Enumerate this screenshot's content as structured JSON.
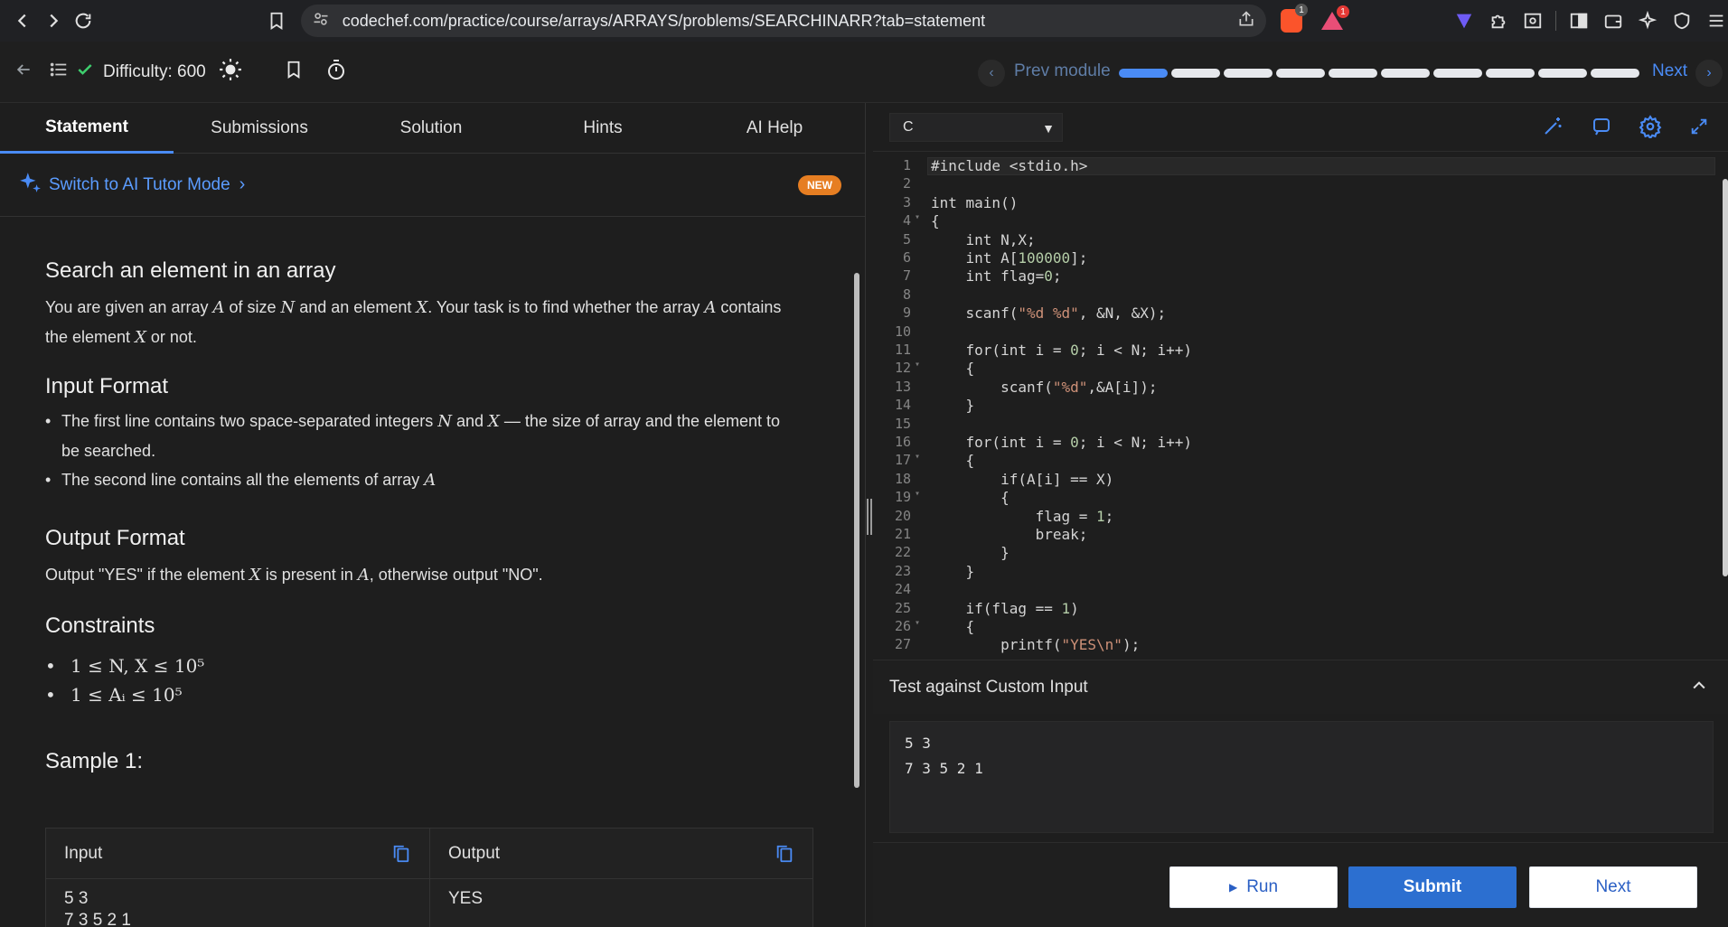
{
  "browser": {
    "url": "codechef.com/practice/course/arrays/ARRAYS/problems/SEARCHINARR?tab=statement",
    "shield_badge": "1",
    "alert_badge": "1"
  },
  "appbar": {
    "difficulty": "Difficulty:  600",
    "prev_label": "Prev module",
    "next_label": "Next",
    "progress_total": 10,
    "progress_done": 1
  },
  "tabs": [
    "Statement",
    "Submissions",
    "Solution",
    "Hints",
    "AI Help"
  ],
  "ai_tutor": {
    "link": "Switch to AI Tutor Mode",
    "badge": "NEW"
  },
  "problem": {
    "title": "Search an element in an array",
    "description": {
      "p1": "You are given an array ",
      "A": "A",
      "p2": " of size ",
      "N": "N",
      "p3": " and an element ",
      "X": "X",
      "p4": ". Your task is to find whether the array ",
      "p5": " contains",
      "p6": "the element ",
      "p7": " or not."
    },
    "input_format_title": "Input Format",
    "input_bullets": {
      "b1_a": "The first line contains two space-separated integers ",
      "b1_and": " and ",
      "b1_b": " — the size of array and the element to",
      "b1_c": "be searched.",
      "b2": "The second line contains all the elements of array "
    },
    "output_format_title": "Output Format",
    "output": {
      "o1": "Output \"YES\" if the element ",
      "o2": " is present in ",
      "o3": ", otherwise output \"NO\"."
    },
    "constraints_title": "Constraints",
    "constraints": [
      "1 ≤ N, X ≤ 10⁵",
      "1 ≤ Aᵢ ≤ 10⁵"
    ],
    "sample_title": "Sample 1:",
    "sample": {
      "input_label": "Input",
      "output_label": "Output",
      "input_line1": "5 3",
      "input_line2": "7 3 5 2 1",
      "output_value": "YES"
    }
  },
  "editor": {
    "language": "C",
    "lines": [
      "#include <stdio.h>",
      "",
      "int main()",
      "{",
      "    int N,X;",
      "    int A[100000];",
      "    int flag=0;",
      "",
      "    scanf(\"%d %d\", &N, &X);",
      "",
      "    for(int i = 0; i < N; i++)",
      "    {",
      "        scanf(\"%d\",&A[i]);",
      "    }",
      "",
      "    for(int i = 0; i < N; i++)",
      "    {",
      "        if(A[i] == X)",
      "        {",
      "            flag = 1;",
      "            break;",
      "        }",
      "    }",
      "",
      "    if(flag == 1)",
      "    {",
      "        printf(\"YES\\n\");"
    ],
    "fold_lines": [
      4,
      12,
      17,
      19,
      26
    ]
  },
  "custom_input": {
    "title": "Test against Custom Input",
    "value": "5 3\n7 3 5 2 1"
  },
  "actions": {
    "run": "Run",
    "submit": "Submit",
    "next": "Next"
  }
}
